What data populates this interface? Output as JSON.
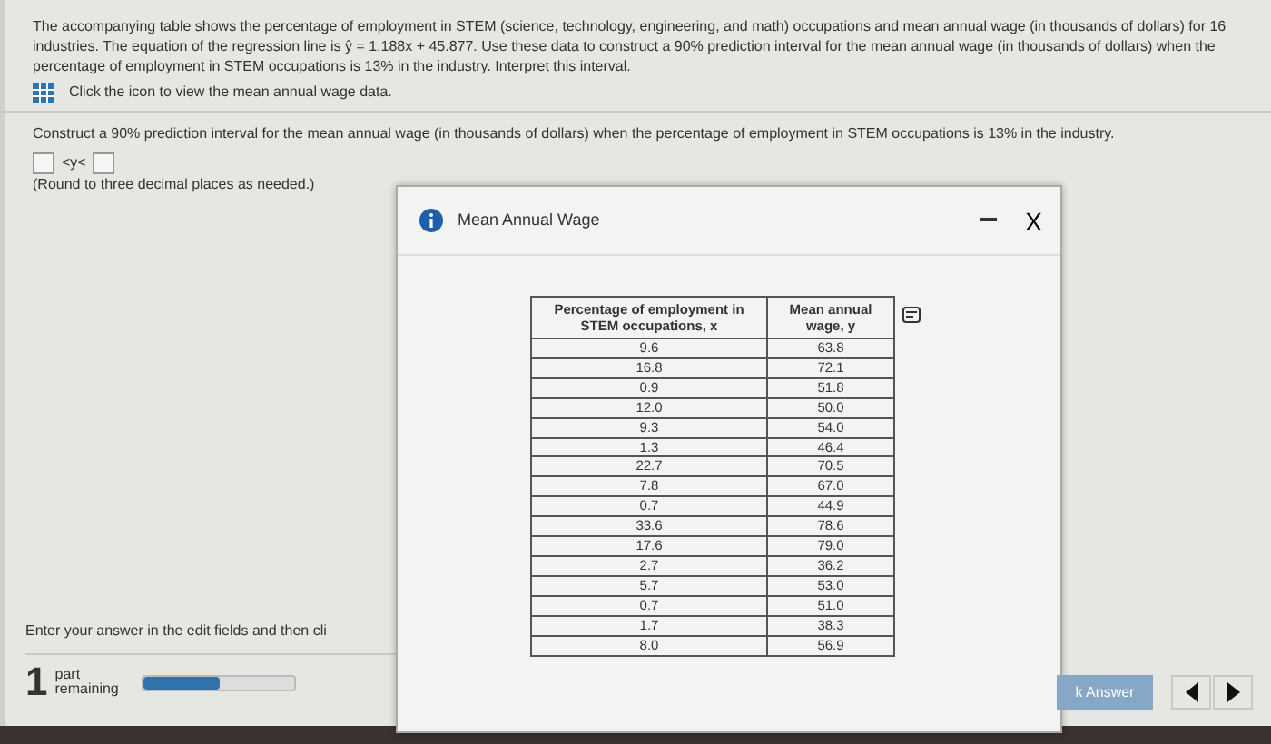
{
  "problem": {
    "intro": "The accompanying table shows the percentage of employment in STEM (science, technology, engineering, and math) occupations and mean annual wage (in thousands of dollars) for 16 industries. The equation of the regression line is ŷ = 1.188x + 45.877. Use these data to construct a 90% prediction interval for the mean annual wage (in thousands of dollars) when the percentage of employment in STEM occupations is 13% in the industry. Interpret this interval.",
    "data_link": "Click the icon to view the mean annual wage data."
  },
  "question": {
    "prompt": "Construct a 90% prediction interval for the mean annual wage (in thousands of dollars) when the percentage of employment in STEM occupations is 13% in the industry.",
    "relation": "<y<",
    "note": "(Round to three decimal places as needed.)"
  },
  "footer": {
    "instruction": "Enter your answer in the edit fields and then cli",
    "parts_count": "1",
    "parts_label": "part remaining",
    "level": 0.5,
    "check_button": "k Answer"
  },
  "dialog": {
    "title": "Mean Annual Wage",
    "close": "X",
    "columns": [
      "Percentage of employment in STEM occupations, x",
      "Mean annual wage, y"
    ],
    "rows": [
      [
        "9.6",
        "63.8"
      ],
      [
        "16.8",
        "72.1"
      ],
      [
        "0.9",
        "51.8"
      ],
      [
        "12.0",
        "50.0"
      ],
      [
        "9.3",
        "54.0"
      ],
      [
        "1.3",
        "46.4"
      ],
      [
        "22.7",
        "70.5"
      ],
      [
        "7.8",
        "67.0"
      ],
      [
        "0.7",
        "44.9"
      ],
      [
        "33.6",
        "78.6"
      ],
      [
        "17.6",
        "79.0"
      ],
      [
        "2.7",
        "36.2"
      ],
      [
        "5.7",
        "53.0"
      ],
      [
        "0.7",
        "51.0"
      ],
      [
        "1.7",
        "38.3"
      ],
      [
        "8.0",
        "56.9"
      ]
    ]
  }
}
